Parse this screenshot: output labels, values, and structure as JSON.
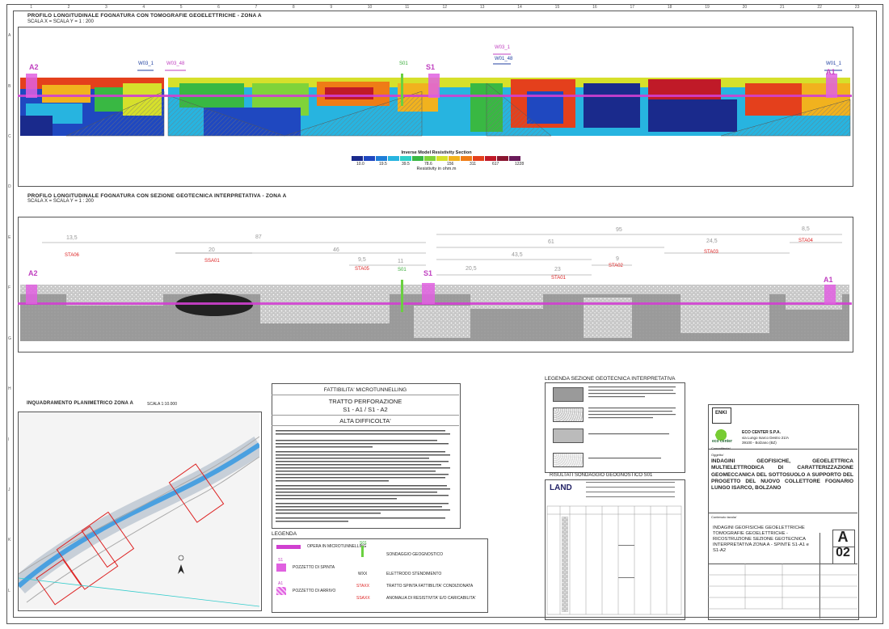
{
  "sheet": {
    "ruler_top": [
      "1",
      "2",
      "3",
      "4",
      "5",
      "6",
      "7",
      "8",
      "9",
      "10",
      "11",
      "12",
      "13",
      "14",
      "15",
      "16",
      "17",
      "18",
      "19",
      "20",
      "21",
      "22",
      "23"
    ],
    "ruler_left": [
      "A",
      "B",
      "C",
      "D",
      "E",
      "F",
      "G",
      "H",
      "I",
      "J",
      "K",
      "L"
    ]
  },
  "profile1": {
    "title": "PROFILO LONGITUDINALE FOGNATURA CON TOMOGRAFIE GEOELETTRICHE  -  ZONA A",
    "scale": "SCALA X = SCALA Y = 1 : 200",
    "markers": {
      "a2": "A2",
      "s1": "S1",
      "a1": "A1",
      "s01": "S01",
      "w03_1_left": "W03_1",
      "w03_48_left": "W03_48",
      "w03_1_right": "W03_1",
      "w01_48": "W01_48",
      "w01_1": "W01_1"
    },
    "legend_title": "Inverse Model Resistivity Section",
    "legend_values": [
      "10.0",
      "19.5",
      "39.5",
      "78.6",
      "156",
      "311",
      "617",
      "1228"
    ],
    "legend_unit": "Resistivity in ohm.m",
    "legend_colors": [
      "#1a2a8c",
      "#1f48c0",
      "#1e7ed8",
      "#27b4e0",
      "#2fd0c8",
      "#39b843",
      "#7fd33a",
      "#d6e02b",
      "#f1b21e",
      "#ef7c16",
      "#e4401c",
      "#c01a28",
      "#8a1630",
      "#6a1a5a"
    ]
  },
  "profile2": {
    "title": "PROFILO LONGITUDINALE FOGNATURA CON SEZIONE GEOTECNICA INTERPRETATIVA  -  ZONA A",
    "scale": "SCALA X = SCALA Y = 1 : 200",
    "markers": {
      "a2": "A2",
      "s1": "S1",
      "a1": "A1",
      "s01": "S01"
    },
    "dims": {
      "d13_5": "13,5",
      "d87": "87",
      "d20": "20",
      "d46": "46",
      "d9_5": "9,5",
      "d11": "11",
      "d95": "95",
      "d8_5": "8,5",
      "d61": "61",
      "d24_5": "24,5",
      "d43_5": "43,5",
      "d9": "9",
      "d20_5": "20,5",
      "d23": "23"
    },
    "zones": {
      "sta06": "STA06",
      "ssa01": "SSA01",
      "sta05": "STA05",
      "sta04": "STA04",
      "sta03": "STA03",
      "sta02": "STA02",
      "sta01": "STA01"
    }
  },
  "plan": {
    "title": "INQUADRAMENTO PLANIMETRICO ZONA A",
    "scale": "SCALA 1:10.000"
  },
  "feasibility": {
    "title": "FATTIBILITA' MICROTUNNELLING",
    "subtitle": "TRATTO PERFORAZIONE",
    "segment": "S1 - A1  /  S1 - A2",
    "difficulty": "ALTA DIFFICOLTA'"
  },
  "legend": {
    "title": "LEGENDA",
    "items": {
      "opera": "OPERA IN MICROTUNNELLING",
      "pozzetto_spinta": "POZZETTO DI SPINTA",
      "pozzetto_arrivo": "POZZETTO DI ARRIVO",
      "sondaggio": "SONDAGGIO GEOGNOSTICO",
      "wxx": "WXX",
      "elettrodo": "ELETTRODO STENDIMENTO",
      "staxx": "STAXX",
      "tratto": "TRATTO SPINTA FATTIBILITA' CONDIZIONATA",
      "ssaxx": "SSAXX",
      "anomalia": "ANOMALIA DI RESISTIVITA' E/O CARICABILITA'",
      "s1_tag": "S1",
      "a1_tag": "A1",
      "s01_tag": "S01"
    }
  },
  "geo_legend": {
    "title": "LEGENDA SEZIONE GEOTECNICA INTERPRETATIVA"
  },
  "borehole": {
    "title": "RISULTATI SONDAGGIO GEOGNOSTICO S01",
    "logo": "LAND"
  },
  "titleblock": {
    "company1": "ENKI",
    "company2": "ECO CENTER S.P.A.",
    "company2_addr1": "via Lungo Isarco Destro 21/A",
    "company2_addr2": "39100 - Bolzano (BZ)",
    "eco_logo": "eco center",
    "committente": "Committente/",
    "oggetto": "Oggetto/",
    "main_title": "INDAGINI GEOFISICHE, GEOELETTRICA MULTIELETTRODICA DI CARATTERIZZAZIONE GEOMECCANICA DEL SOTTOSUOLO A SUPPORTO DEL PROGETTO DEL NUOVO COLLETTORE FOGNARIO LUNGO ISARCO, BOLZANO",
    "contenuto": "Contenuto tavola/",
    "sub_title": "INDAGINI GEOFISICHE GEOELETTRICHE TOMOGRAFIE GEOELETTRICHE - RICOSTRUZIONE SEZIONE GEOTECNICA INTERPRETATIVA ZONA A - SPINTE S1-A1 e S1-A2",
    "sheet_letter": "A",
    "sheet_number": "02"
  }
}
